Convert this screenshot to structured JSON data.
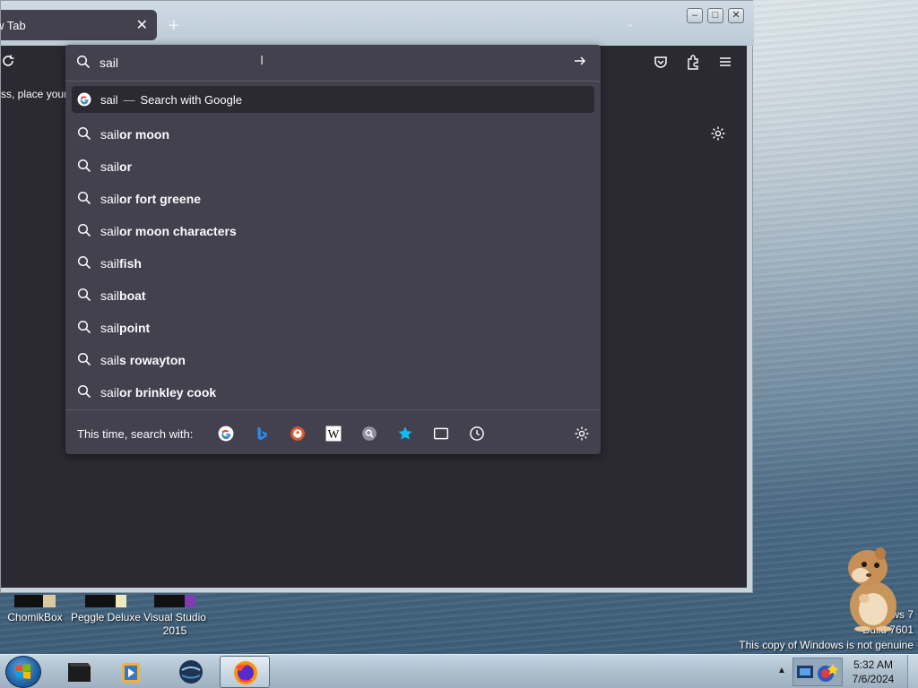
{
  "browser": {
    "tab": {
      "title": "w Tab",
      "close": "✕"
    },
    "new_tab": "+",
    "window_controls": {
      "minimize": "–",
      "maximize": "□",
      "close": "✕"
    },
    "bookmarks_hint": "ss, place your l"
  },
  "urlbar": {
    "query": "sail",
    "go_icon": "arrow-right-icon",
    "results": [
      {
        "typed": "sail",
        "suggestion": "",
        "dash": "—",
        "action": "Search with Google",
        "icon": "google-icon",
        "selected": true
      },
      {
        "typed": "sail",
        "suggestion": "or moon",
        "icon": "search-icon"
      },
      {
        "typed": "sail",
        "suggestion": "or",
        "icon": "search-icon"
      },
      {
        "typed": "sail",
        "suggestion": "or fort greene",
        "icon": "search-icon"
      },
      {
        "typed": "sail",
        "suggestion": "or moon characters",
        "icon": "search-icon"
      },
      {
        "typed": "sail",
        "suggestion": "fish",
        "icon": "search-icon"
      },
      {
        "typed": "sail",
        "suggestion": "boat",
        "icon": "search-icon"
      },
      {
        "typed": "sail",
        "suggestion": "point",
        "icon": "search-icon"
      },
      {
        "typed": "sail",
        "suggestion": "s rowayton",
        "icon": "search-icon"
      },
      {
        "typed": "sail",
        "suggestion": "or brinkley cook",
        "icon": "search-icon"
      }
    ],
    "one_off": {
      "label": "This time, search with:",
      "engines": [
        "google-icon",
        "bing-icon",
        "duckduckgo-icon",
        "wikipedia-icon",
        "search-engine-icon",
        "bookmarks-icon",
        "tabs-icon",
        "history-icon"
      ],
      "wikipedia_glyph": "W"
    }
  },
  "desktop": {
    "icons": [
      {
        "label": "ChomikBox"
      },
      {
        "label": "Peggle Deluxe"
      },
      {
        "label": "Visual Studio 2015"
      }
    ],
    "watermark_line1": "ws 7",
    "watermark_line2": "Build 7601",
    "watermark_line3": "This copy of Windows is not genuine"
  },
  "taskbar": {
    "time": "5:32 AM",
    "date": "7/6/2024",
    "tray_arrow": "▲"
  },
  "colors": {
    "firefox_dark": "#2b2a33",
    "popup_bg": "#42414d",
    "text": "#fbfbfe",
    "taskbar": "#aebfcd"
  }
}
